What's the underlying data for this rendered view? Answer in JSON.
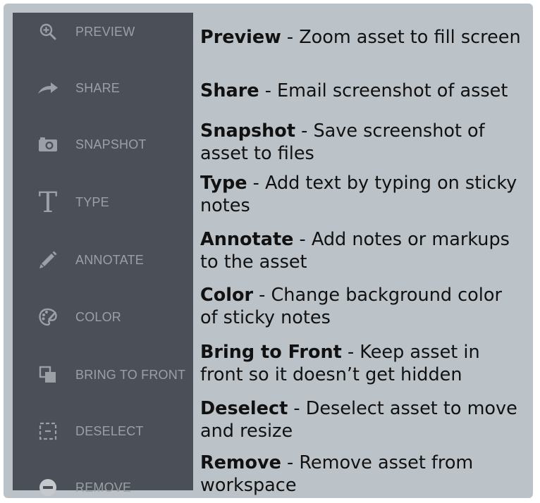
{
  "colors": {
    "panel_background": "#bcc3c8",
    "sidebar_background": "#4b5058",
    "sidebar_text": "#9aa0a6",
    "description_text": "#111111"
  },
  "sidebar": {
    "items": [
      {
        "label": "PREVIEW",
        "icon": "zoom-in-icon"
      },
      {
        "label": "SHARE",
        "icon": "share-arrow-icon"
      },
      {
        "label": "SNAPSHOT",
        "icon": "camera-icon"
      },
      {
        "label": "TYPE",
        "icon": "text-type-icon"
      },
      {
        "label": "ANNOTATE",
        "icon": "pencil-icon"
      },
      {
        "label": "COLOR",
        "icon": "palette-icon"
      },
      {
        "label": "BRING TO FRONT",
        "icon": "bring-to-front-icon"
      },
      {
        "label": "DESELECT",
        "icon": "deselect-icon"
      },
      {
        "label": "REMOVE",
        "icon": "remove-icon"
      }
    ]
  },
  "descriptions": [
    {
      "title": "Preview",
      "text": " - Zoom asset to fill screen"
    },
    {
      "title": "Share",
      "text": " - Email screenshot of asset"
    },
    {
      "title": "Snapshot",
      "line1": " - Save screenshot of",
      "line2": "asset to files"
    },
    {
      "title": "Type",
      "line1": " - Add text by typing on sticky",
      "line2": "notes"
    },
    {
      "title": "Annotate",
      "line1": " - Add notes or markups",
      "line2": "to the asset"
    },
    {
      "title": "Color",
      "line1": " - Change background color",
      "line2": "of sticky notes"
    },
    {
      "title": "Bring to Front",
      "line1": " - Keep asset in",
      "line2": "front so it doesn’t get hidden"
    },
    {
      "title": "Deselect",
      "line1": " - Deselect asset to move",
      "line2": "and resize"
    },
    {
      "title": "Remove",
      "line1": " - Remove asset from",
      "line2": "workspace"
    }
  ]
}
